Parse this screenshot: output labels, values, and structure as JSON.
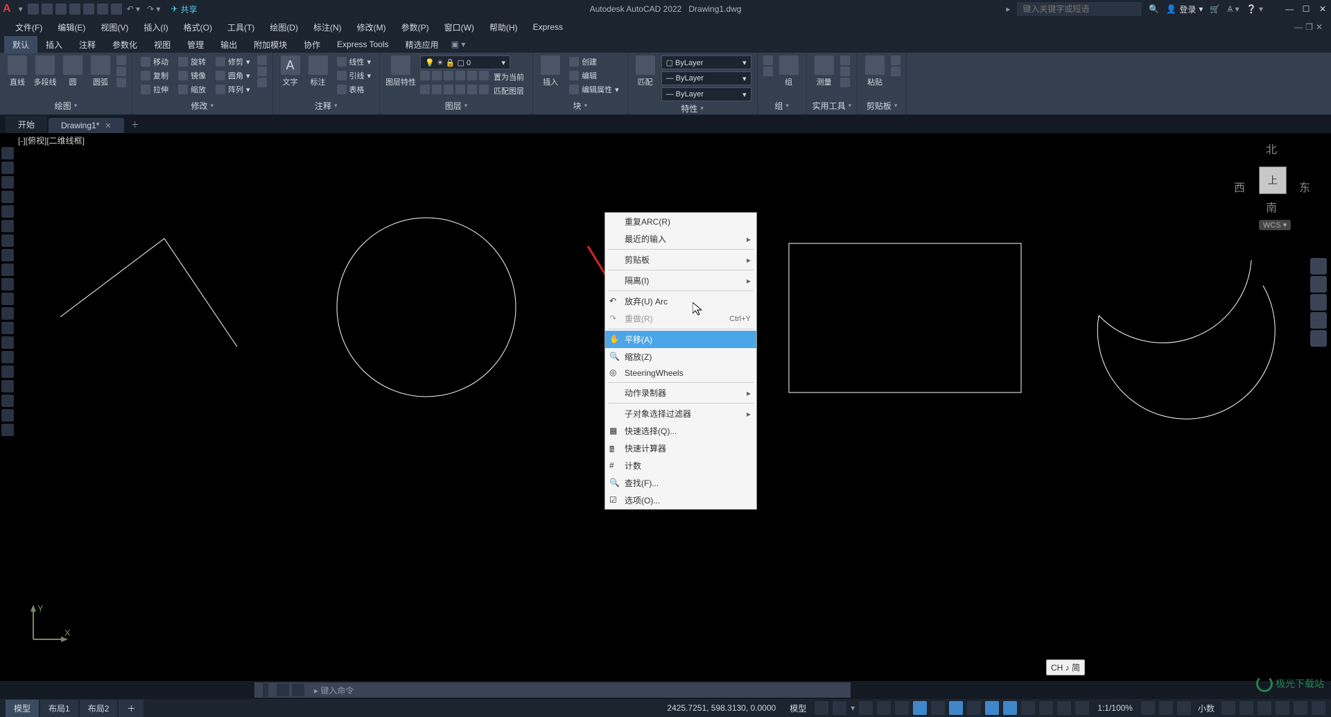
{
  "app": {
    "title": "Autodesk AutoCAD 2022",
    "file": "Drawing1.dwg",
    "search_placeholder": "键入关键字或短语",
    "login": "登录",
    "share": "共享"
  },
  "menu": [
    "文件(F)",
    "编辑(E)",
    "视图(V)",
    "插入(I)",
    "格式(O)",
    "工具(T)",
    "绘图(D)",
    "标注(N)",
    "修改(M)",
    "参数(P)",
    "窗口(W)",
    "帮助(H)",
    "Express"
  ],
  "ribtabs": [
    "默认",
    "插入",
    "注释",
    "参数化",
    "视图",
    "管理",
    "输出",
    "附加模块",
    "协作",
    "Express Tools",
    "精选应用"
  ],
  "draw": {
    "title": "绘图",
    "b": [
      "直线",
      "多段线",
      "圆",
      "圆弧"
    ]
  },
  "modify": {
    "title": "修改",
    "r1": [
      "移动",
      "旋转",
      "修剪"
    ],
    "r2": [
      "复制",
      "镜像",
      "圆角"
    ],
    "r3": [
      "拉伸",
      "缩放",
      "阵列"
    ]
  },
  "annot": {
    "title": "注释",
    "b": [
      "文字",
      "标注"
    ],
    "r": [
      "引线",
      "表格"
    ],
    "line": "线性"
  },
  "layer": {
    "title": "图层",
    "b": "图层特性",
    "r": [
      "置为当前",
      "匹配图层"
    ],
    "sel": "0"
  },
  "block": {
    "title": "块",
    "b": "插入",
    "r": [
      "创建",
      "编辑",
      "编辑属性"
    ]
  },
  "prop": {
    "title": "特性",
    "b": "特性",
    "opts": [
      "ByLayer",
      "ByLayer",
      "ByLayer"
    ],
    "match": "匹配"
  },
  "group": {
    "title": "组",
    "b": "组"
  },
  "util": {
    "title": "实用工具",
    "b": [
      "测量"
    ]
  },
  "clip": {
    "title": "剪贴板",
    "b": "粘贴"
  },
  "filetabs": {
    "start": "开始",
    "file": "Drawing1*"
  },
  "drawlabel": "[-][俯视][二维线框]",
  "vc": {
    "n": "北",
    "s": "南",
    "e": "东",
    "w": "西",
    "top": "上",
    "wcs": "WCS"
  },
  "ctx": {
    "repeat": "重复ARC(R)",
    "recent": "最近的输入",
    "clipboard": "剪贴板",
    "isolate": "隔离(I)",
    "undo": "放弃(U) Arc",
    "redo": "重做(R)",
    "redo_sc": "Ctrl+Y",
    "pan": "平移(A)",
    "zoom": "缩放(Z)",
    "sw": "SteeringWheels",
    "macro": "动作录制器",
    "subfilter": "子对象选择过滤器",
    "qselect": "快速选择(Q)...",
    "qcalc": "快速计算器",
    "count": "计数",
    "find": "查找(F)...",
    "options": "选项(O)..."
  },
  "ime": "CH ♪ 简",
  "cmd": {
    "placeholder": "键入命令"
  },
  "ml": {
    "model": "模型",
    "l1": "布局1",
    "l2": "布局2"
  },
  "status": {
    "coords": "2425.7251, 598.3130, 0.0000",
    "model": "模型",
    "zoom": "1:1/100%",
    "dec": "小数"
  },
  "wm": "极光下载站",
  "ucs": {
    "x": "X",
    "y": "Y"
  }
}
